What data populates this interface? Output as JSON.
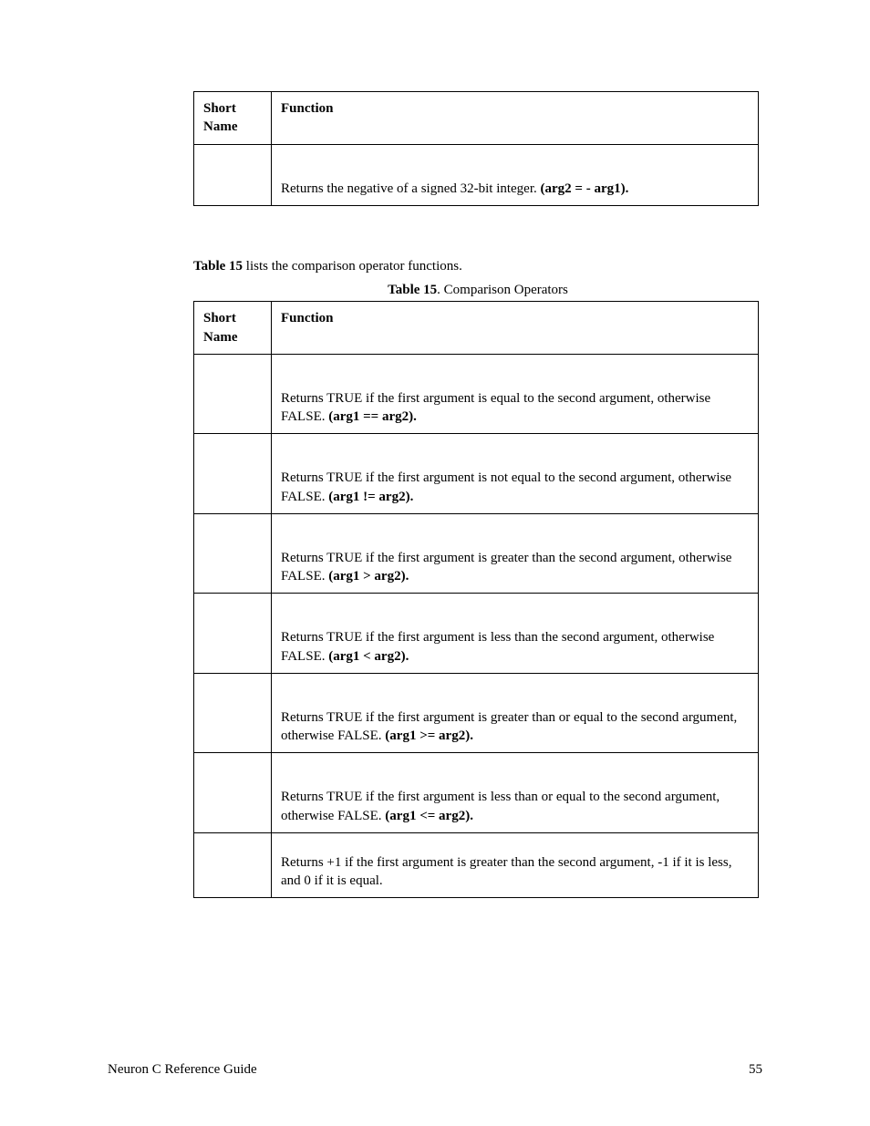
{
  "footer": {
    "title": "Neuron C Reference Guide",
    "page": "55"
  },
  "table1": {
    "headers": {
      "short": "Short Name",
      "fn": "Function"
    },
    "rows": [
      {
        "short": "",
        "desc": "Returns the negative of a signed 32-bit integer. ",
        "expr": "(arg2 = - arg1)"
      }
    ]
  },
  "intro": {
    "lead": "Table 15",
    "rest": " lists the comparison operator functions."
  },
  "caption": {
    "lead": "Table 15",
    "rest": ". Comparison Operators"
  },
  "table2": {
    "headers": {
      "short": "Short Name",
      "fn": "Function"
    },
    "rows": [
      {
        "short": "",
        "desc": "Returns TRUE if the first argument is equal to the second argument, otherwise FALSE. ",
        "expr": "(arg1 == arg2)"
      },
      {
        "short": "",
        "desc": "Returns TRUE if the first argument is not equal to the second argument, otherwise FALSE. ",
        "expr": "(arg1 != arg2)"
      },
      {
        "short": "",
        "desc": "Returns TRUE if the first argument is greater than the second argument, otherwise FALSE. ",
        "expr": "(arg1 > arg2)"
      },
      {
        "short": "",
        "desc": "Returns TRUE if the first argument is less than the second argument, otherwise FALSE. ",
        "expr": "(arg1 < arg2)"
      },
      {
        "short": "",
        "desc": "Returns TRUE if the first argument is greater than or equal to the second argument, otherwise FALSE. ",
        "expr": "(arg1 >= arg2)"
      },
      {
        "short": "",
        "desc": "Returns TRUE if the first argument is less than or equal to the second argument, otherwise FALSE. ",
        "expr": "(arg1 <= arg2)"
      },
      {
        "short": "",
        "desc": "Returns +1 if the first argument is greater than the second argument, -1 if it is less, and 0 if it is equal.",
        "expr": ""
      }
    ]
  }
}
